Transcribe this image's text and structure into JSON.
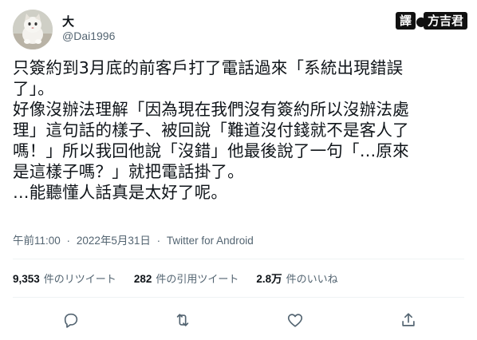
{
  "user": {
    "display_name": "大",
    "handle": "@Dai1996"
  },
  "credit": {
    "label": "譯",
    "translator": "方吉君"
  },
  "tweet": {
    "lines": [
      "只簽約到3月底的前客戶打了電話過來「系統出現錯誤",
      "了」。",
      "好像沒辦法理解「因為現在我們沒有簽約所以沒辦法處",
      "理」這句話的樣子、被回說「難道沒付錢就不是客人了",
      "嗎！」所以我回他說「沒錯」他最後說了一句「…原來",
      "是這樣子嗎？」就把電話掛了。",
      "…能聽懂人話真是太好了呢。"
    ]
  },
  "meta": {
    "time": "午前11:00",
    "date": "2022年5月31日",
    "source": "Twitter for Android",
    "separator": "·"
  },
  "stats": {
    "retweets": {
      "count": "9,353",
      "label": "件のリツイート"
    },
    "quotes": {
      "count": "282",
      "label": "件の引用ツイート"
    },
    "likes": {
      "count": "2.8万",
      "label": "件のいいね"
    }
  },
  "actions": {
    "icons": [
      "reply-icon",
      "retweet-icon",
      "like-icon",
      "share-icon"
    ],
    "color": "#536471"
  },
  "colors": {
    "text": "#0f1419",
    "secondary": "#536471",
    "divider": "#eff3f4"
  }
}
